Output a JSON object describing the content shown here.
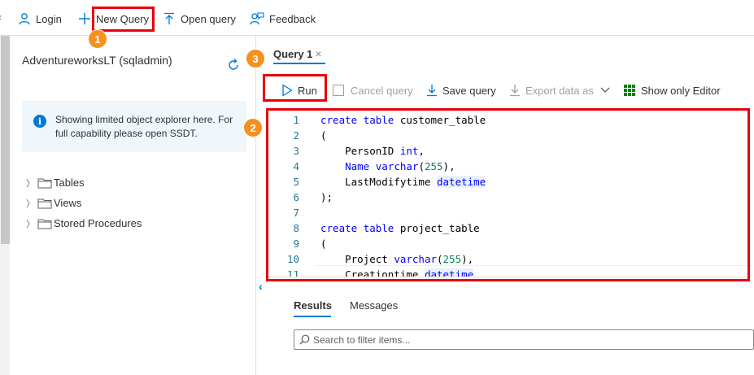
{
  "toolbar": {
    "login_label": "Login",
    "new_query_label": "New Query",
    "open_query_label": "Open query",
    "feedback_label": "Feedback"
  },
  "explorer": {
    "db_title": "AdventureworksLT (sqladmin)",
    "info_text": "Showing limited object explorer here. For full capability please open SSDT.",
    "tree": [
      {
        "label": "Tables"
      },
      {
        "label": "Views"
      },
      {
        "label": "Stored Procedures"
      }
    ]
  },
  "query_tab": {
    "title": "Query 1",
    "close_glyph": "×"
  },
  "query_toolbar": {
    "run_label": "Run",
    "cancel_label": "Cancel query",
    "save_label": "Save query",
    "export_label": "Export data as",
    "show_editor_label": "Show only Editor"
  },
  "editor": {
    "line_numbers": [
      "1",
      "2",
      "3",
      "4",
      "5",
      "6",
      "7",
      "8",
      "9",
      "10",
      "11"
    ]
  },
  "results": {
    "results_tab": "Results",
    "messages_tab": "Messages",
    "filter_placeholder": "Search to filter items..."
  },
  "annotations": {
    "badge_1": "1",
    "badge_2": "2",
    "badge_3": "3"
  },
  "colors": {
    "accent": "#0078d4",
    "highlight": "#e8000b",
    "badge": "#f7901e",
    "keyword": "#0000ff"
  }
}
